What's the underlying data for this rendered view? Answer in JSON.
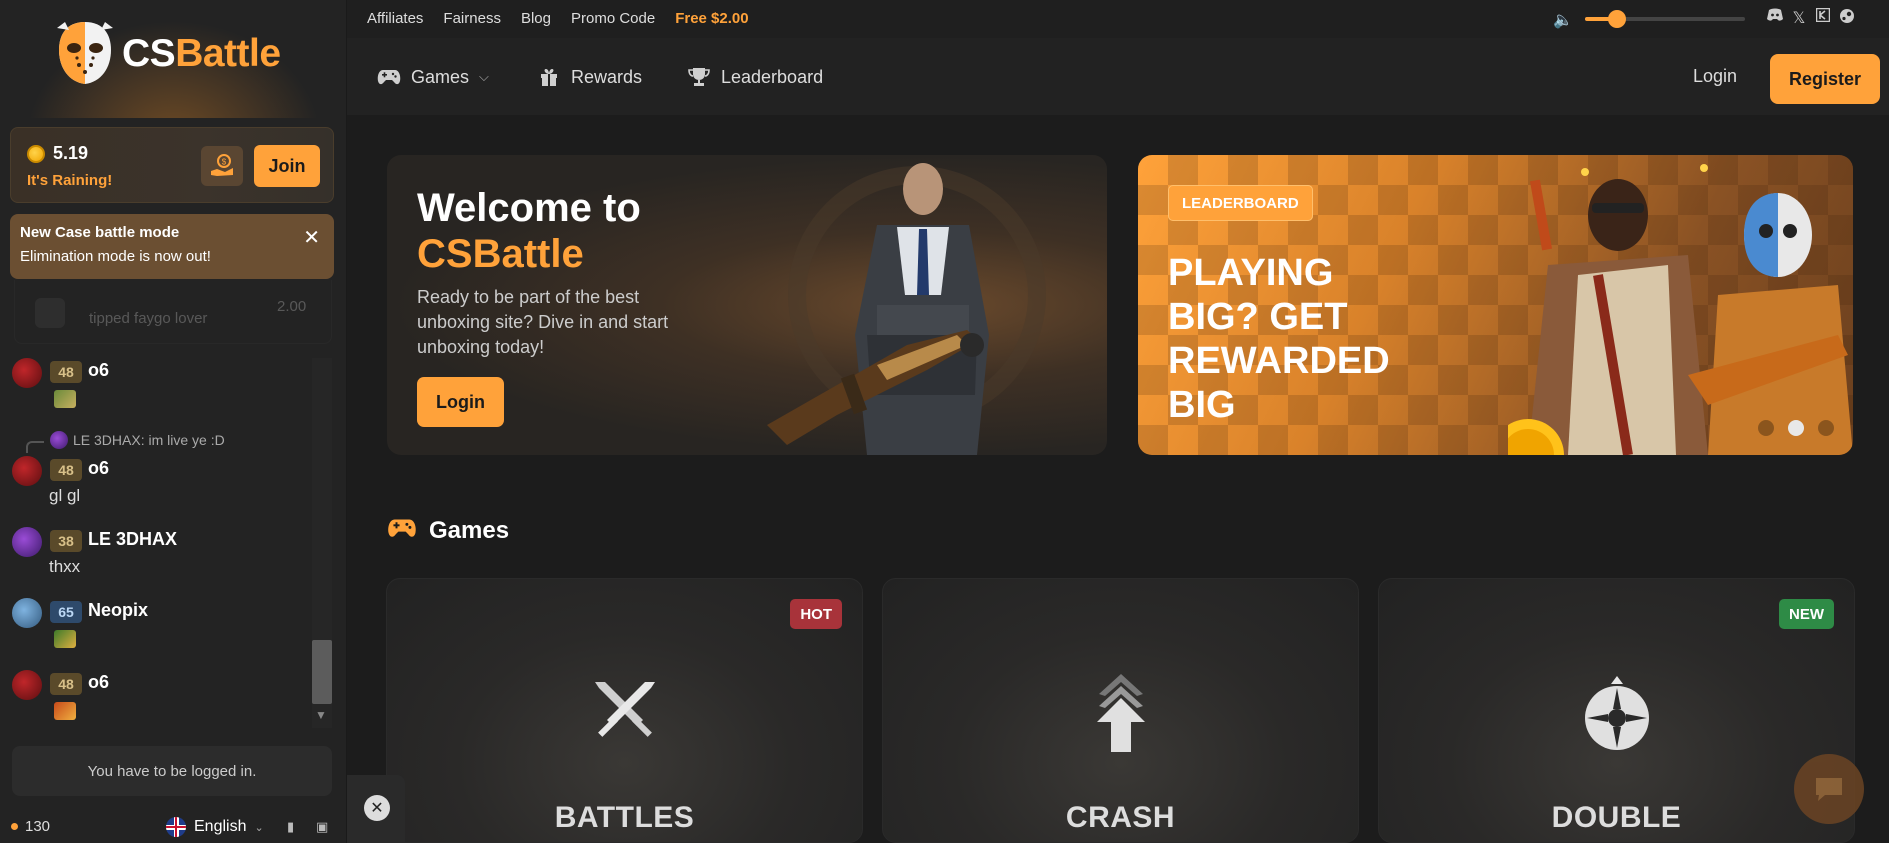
{
  "brand": {
    "name_part1": "CS",
    "name_part2": "Battle"
  },
  "rain": {
    "amount": "5.19",
    "label": "It's Raining!",
    "join_label": "Join"
  },
  "notice": {
    "title": "New Case battle mode",
    "body": "Elimination mode is now out!",
    "close": "✕"
  },
  "ghost_tip": {
    "text": "tipped faygo lover",
    "value": "2.00"
  },
  "chat": [
    {
      "level": "48",
      "user": "o6",
      "text": "",
      "sticker": true,
      "avatar": "red",
      "level_style": "gold"
    },
    {
      "reply_to": "LE 3DHAX: im live ye :D"
    },
    {
      "level": "48",
      "user": "o6",
      "text": "gl gl",
      "avatar": "red",
      "level_style": "gold"
    },
    {
      "level": "38",
      "user": "LE 3DHAX",
      "text": "thxx",
      "avatar": "purple",
      "level_style": "gold"
    },
    {
      "level": "65",
      "user": "Neopix",
      "text": "",
      "sticker": true,
      "avatar": "blue",
      "level_style": "blue"
    },
    {
      "level": "48",
      "user": "o6",
      "text": "",
      "sticker": true,
      "avatar": "red",
      "level_style": "gold"
    }
  ],
  "login_required": "You have to be logged in.",
  "footer": {
    "online_count": "130",
    "language": "English"
  },
  "topbar": {
    "links": [
      "Affiliates",
      "Fairness",
      "Blog",
      "Promo Code"
    ],
    "free_link": "Free $2.00",
    "volume_fraction": 0.2
  },
  "nav": {
    "items": [
      "Games",
      "Rewards",
      "Leaderboard"
    ],
    "login": "Login",
    "register": "Register"
  },
  "hero1": {
    "title_line1": "Welcome to",
    "title_line2": "CSBattle",
    "subtitle": "Ready to be part of the best unboxing site? Dive in and start unboxing today!",
    "button": "Login"
  },
  "hero2": {
    "badge": "LEADERBOARD",
    "title": "PLAYING BIG? GET REWARDED BIG",
    "active_slide": 2,
    "slides": 3
  },
  "games_section": {
    "title": "Games"
  },
  "games": [
    {
      "name": "BATTLES",
      "tag": "HOT"
    },
    {
      "name": "CRASH",
      "tag": ""
    },
    {
      "name": "DOUBLE",
      "tag": "NEW"
    }
  ],
  "colors": {
    "accent": "#ffa23a",
    "hot": "#a8333a",
    "new": "#2e8b46"
  }
}
